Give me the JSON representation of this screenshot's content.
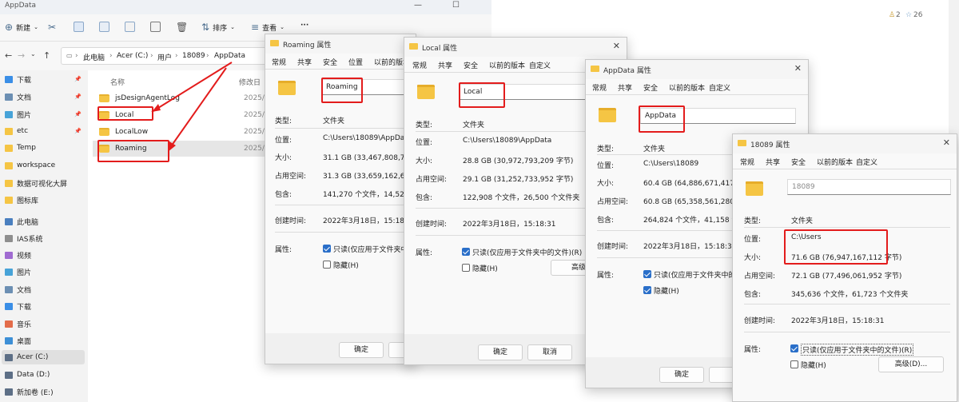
{
  "explorer": {
    "title": "AppData",
    "toolbar": {
      "new_label": "新建",
      "sort_label": "排序",
      "view_label": "查看",
      "more_label": "···"
    },
    "breadcrumb": [
      "此电脑",
      "Acer (C:)",
      "用户",
      "18089",
      "AppData"
    ],
    "columns": {
      "name": "名称",
      "modified": "修改日"
    },
    "files": [
      {
        "name": "jsDesignAgentLog",
        "date": "2025/4"
      },
      {
        "name": "Local",
        "date": "2025/0"
      },
      {
        "name": "LocalLow",
        "date": "2025/0"
      },
      {
        "name": "Roaming",
        "date": "2025/0"
      }
    ],
    "sidebar": [
      {
        "label": "下载",
        "color": "#3a8ee6"
      },
      {
        "label": "文档",
        "color": "#6c8fb3"
      },
      {
        "label": "图片",
        "color": "#47a3d8"
      },
      {
        "label": "etc",
        "color": "#f5c544"
      },
      {
        "label": "Temp",
        "color": "#f5c544"
      },
      {
        "label": "workspace",
        "color": "#f5c544"
      },
      {
        "label": "数据可视化大屏",
        "color": "#f5c544"
      },
      {
        "label": "图标库",
        "color": "#f5c544"
      },
      {
        "label": "此电脑",
        "color": "#4a7fbf"
      },
      {
        "label": "IAS系统",
        "color": "#8e8e8e"
      },
      {
        "label": "视频",
        "color": "#a06bd1"
      },
      {
        "label": "图片",
        "color": "#47a3d8"
      },
      {
        "label": "文档",
        "color": "#6c8fb3"
      },
      {
        "label": "下载",
        "color": "#3a8ee6"
      },
      {
        "label": "音乐",
        "color": "#e36c4a"
      },
      {
        "label": "桌面",
        "color": "#3d8fd6"
      },
      {
        "label": "Acer (C:)",
        "color": "#5d6f86"
      },
      {
        "label": "Data (D:)",
        "color": "#5d6f86"
      },
      {
        "label": "新加卷 (E:)",
        "color": "#5d6f86"
      }
    ]
  },
  "editor": {
    "likes": "2",
    "stars": "26"
  },
  "dialogs": {
    "roaming": {
      "title": "Roaming 属性",
      "tabs": [
        "常规",
        "共享",
        "安全",
        "位置",
        "以前的版本"
      ],
      "name": "Roaming",
      "type_label": "类型:",
      "type": "文件夹",
      "location_label": "位置:",
      "location": "C:\\Users\\18089\\AppData",
      "size_label": "大小:",
      "size": "31.1 GB (33,467,808,747 字",
      "disk_label": "占用空间:",
      "disk": "31.3 GB (33,659,162,624 字",
      "contains_label": "包含:",
      "contains": "141,270 个文件，14,526 个",
      "created_label": "创建时间:",
      "created": "2022年3月18日，15:18:31",
      "attr_label": "属性:",
      "readonly": "只读(仅应用于文件夹中的",
      "hidden": "隐藏(H)",
      "ok": "确定",
      "cancel": ""
    },
    "local": {
      "title": "Local 属性",
      "tabs": [
        "常规",
        "共享",
        "安全",
        "以前的版本",
        "自定义"
      ],
      "name": "Local",
      "type_label": "类型:",
      "type": "文件夹",
      "location_label": "位置:",
      "location": "C:\\Users\\18089\\AppData",
      "size_label": "大小:",
      "size": "28.8 GB (30,972,793,209 字节)",
      "disk_label": "占用空间:",
      "disk": "29.1 GB (31,252,733,952 字节)",
      "contains_label": "包含:",
      "contains": "122,908 个文件，26,500 个文件夹",
      "created_label": "创建时间:",
      "created": "2022年3月18日，15:18:31",
      "attr_label": "属性:",
      "readonly": "只读(仅应用于文件夹中的文件)(R)",
      "hidden": "隐藏(H)",
      "advanced": "高级",
      "ok": "确定",
      "cancel": "取消"
    },
    "appdata": {
      "title": "AppData 属性",
      "tabs": [
        "常规",
        "共享",
        "安全",
        "以前的版本",
        "自定义"
      ],
      "name": "AppData",
      "type_label": "类型:",
      "type": "文件夹",
      "location_label": "位置:",
      "location": "C:\\Users\\18089",
      "size_label": "大小:",
      "size": "60.4 GB (64,886,671,417 字节",
      "disk_label": "占用空间:",
      "disk": "60.8 GB (65,358,561,280 字节",
      "contains_label": "包含:",
      "contains": "264,824 个文件，41,158 个文",
      "created_label": "创建时间:",
      "created": "2022年3月18日，15:18:31",
      "attr_label": "属性:",
      "readonly": "只读(仅应用于文件夹中的",
      "hidden": "隐藏(H)",
      "ok": "确定",
      "cancel": ""
    },
    "user": {
      "title": "18089 属性",
      "tabs": [
        "常规",
        "共享",
        "安全",
        "以前的版本",
        "自定义"
      ],
      "name": "18089",
      "type_label": "类型:",
      "type": "文件夹",
      "location_label": "位置:",
      "location": "C:\\Users",
      "size_label": "大小:",
      "size": "71.6 GB (76,947,167,112 字节)",
      "disk_label": "占用空间:",
      "disk": "72.1 GB (77,496,061,952 字节)",
      "contains_label": "包含:",
      "contains": "345,636 个文件，61,723 个文件夹",
      "created_label": "创建时间:",
      "created": "2022年3月18日，15:18:31",
      "attr_label": "属性:",
      "readonly": "只读(仅应用于文件夹中的文件)(R)",
      "hidden": "隐藏(H)",
      "advanced": "高级(D)..."
    }
  },
  "colors": {
    "highlight": "#e31c1c",
    "folder": "#f5c544",
    "accent": "#2a6fc9"
  }
}
